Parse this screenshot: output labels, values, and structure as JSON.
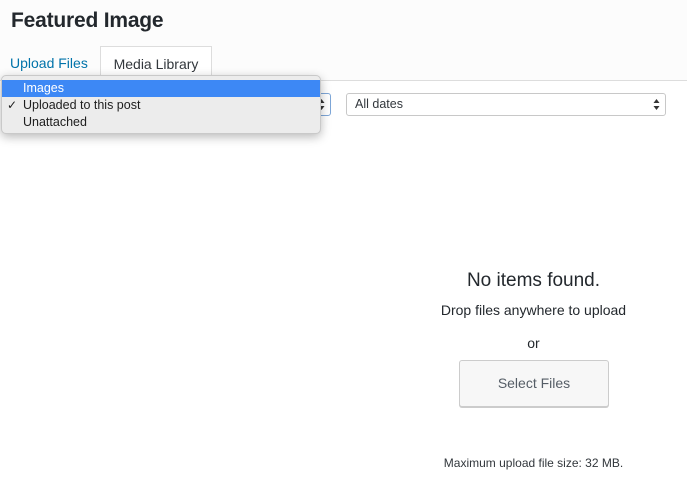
{
  "modal": {
    "title": "Featured Image"
  },
  "tabs": [
    {
      "label": "Upload Files",
      "active": false
    },
    {
      "label": "Media Library",
      "active": true
    }
  ],
  "filters": {
    "type": {
      "options": [
        {
          "label": "Images",
          "highlighted": true,
          "checked": false
        },
        {
          "label": "Uploaded to this post",
          "highlighted": false,
          "checked": true
        },
        {
          "label": "Unattached",
          "highlighted": false,
          "checked": false
        }
      ],
      "check_mark": "✓"
    },
    "dates": {
      "selected": "All dates"
    }
  },
  "empty_state": {
    "title": "No items found.",
    "drop_text": "Drop files anywhere to upload",
    "or_text": "or",
    "select_button": "Select Files",
    "max_size": "Maximum upload file size: 32 MB."
  },
  "colors": {
    "link": "#0073aa",
    "highlight": "#3d88f5",
    "text": "#23282d"
  },
  "icons": {
    "select_arrows": "updown-arrows-icon",
    "check": "checkmark-icon"
  }
}
